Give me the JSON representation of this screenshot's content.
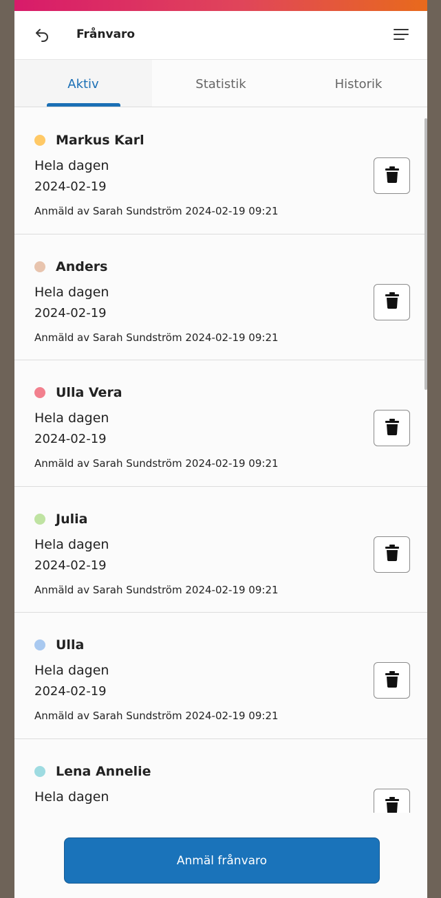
{
  "header": {
    "title": "Frånvaro",
    "back_icon": "back-arrow-icon",
    "menu_icon": "hamburger-menu-icon"
  },
  "tabs": [
    {
      "label": "Aktiv",
      "active": true
    },
    {
      "label": "Statistik",
      "active": false
    },
    {
      "label": "Historik",
      "active": false
    }
  ],
  "colors": {
    "accent": "#1a6fb5",
    "gradient_start": "#d81b6a",
    "gradient_end": "#e86a1c"
  },
  "entries": [
    {
      "name": "Markus Karl",
      "dot_color": "#ffc966",
      "duration": "Hela dagen",
      "date": "2024-02-19",
      "reported": "Anmäld av Sarah Sundström 2024-02-19 09:21"
    },
    {
      "name": "Anders",
      "dot_color": "#e8c4ae",
      "duration": "Hela dagen",
      "date": "2024-02-19",
      "reported": "Anmäld av Sarah Sundström 2024-02-19 09:21"
    },
    {
      "name": "Ulla Vera",
      "dot_color": "#f2808e",
      "duration": "Hela dagen",
      "date": "2024-02-19",
      "reported": "Anmäld av Sarah Sundström 2024-02-19 09:21"
    },
    {
      "name": "Julia",
      "dot_color": "#bfe3a2",
      "duration": "Hela dagen",
      "date": "2024-02-19",
      "reported": "Anmäld av Sarah Sundström 2024-02-19 09:21"
    },
    {
      "name": "Ulla",
      "dot_color": "#a9c9f0",
      "duration": "Hela dagen",
      "date": "2024-02-19",
      "reported": "Anmäld av Sarah Sundström 2024-02-19 09:21"
    },
    {
      "name": "Lena Annelie",
      "dot_color": "#9edbe1",
      "duration": "Hela dagen",
      "date": "",
      "reported": ""
    }
  ],
  "footer": {
    "cta_label": "Anmäl frånvaro"
  }
}
